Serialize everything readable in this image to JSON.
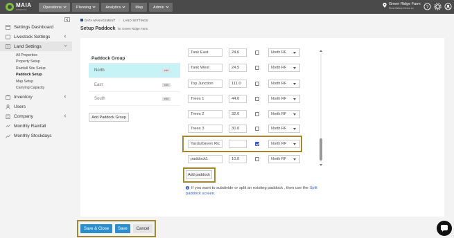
{
  "topbar": {
    "brand": "MAIA",
    "brand_tag": "GRAZING",
    "nav": [
      {
        "label": "Operations"
      },
      {
        "label": "Planning"
      },
      {
        "label": "Analytics"
      },
      {
        "label": "Map"
      },
      {
        "label": "Admin"
      }
    ],
    "farm_name": "Green Ridge Farm",
    "farm_sub": "Rona Beltran Demo co"
  },
  "sidebar": {
    "items": [
      {
        "label": "Settings Dashboard"
      },
      {
        "label": "Livestock Settings"
      },
      {
        "label": "Land Settings"
      },
      {
        "label": "Inventory"
      },
      {
        "label": "Users"
      },
      {
        "label": "Company"
      },
      {
        "label": "Monthly Rainfall"
      },
      {
        "label": "Monthly Stockdays"
      }
    ],
    "sub_items": [
      {
        "label": "All Properties"
      },
      {
        "label": "Property Setup"
      },
      {
        "label": "Rainfall Site Setup"
      },
      {
        "label": "Paddock Setup"
      },
      {
        "label": "Map Setup"
      },
      {
        "label": "Carrying Capacity"
      }
    ]
  },
  "breadcrumb": {
    "part1": "DATA MANAGEMENT",
    "sep": "/",
    "part2": "LAND SETTINGS"
  },
  "page": {
    "title": "Setup Paddock",
    "subtitle": "for Green Ridge Farm"
  },
  "paddock_groups": {
    "header": "Paddock Group",
    "edit_label": "edit",
    "items": [
      {
        "name": "North"
      },
      {
        "name": "East"
      },
      {
        "name": "South"
      }
    ],
    "add_button": "Add Paddock Group"
  },
  "paddocks": {
    "rows": [
      {
        "name": "Tank East",
        "area": "24.6",
        "group": "North RF"
      },
      {
        "name": "Tank West",
        "area": "24.5",
        "group": "North RF"
      },
      {
        "name": "Top Junction",
        "area": "111.0",
        "group": "North RF"
      },
      {
        "name": "Trees 1",
        "area": "44.0",
        "group": "North RF"
      },
      {
        "name": "Trees 2",
        "area": "32.0",
        "group": "North RF"
      },
      {
        "name": "Trees 3",
        "area": "30.0",
        "group": "North RF"
      },
      {
        "name": "Yards/Green Ric",
        "area": "",
        "group": "North RF"
      },
      {
        "name": "paddock1",
        "area": "10.0",
        "group": "North RF"
      }
    ],
    "add_button": "Add paddock"
  },
  "info": {
    "text": "If you want to subdivide or split an existing paddock , then use the",
    "link": "Split paddock screen."
  },
  "footer": {
    "save_close": "Save & Close",
    "save": "Save",
    "cancel": "Cancel"
  },
  "colors": {
    "topbar": "#4a4a4a",
    "primary": "#2b8fcf",
    "highlight_outline": "#a1882a",
    "selected_group": "#c5f3f6"
  }
}
